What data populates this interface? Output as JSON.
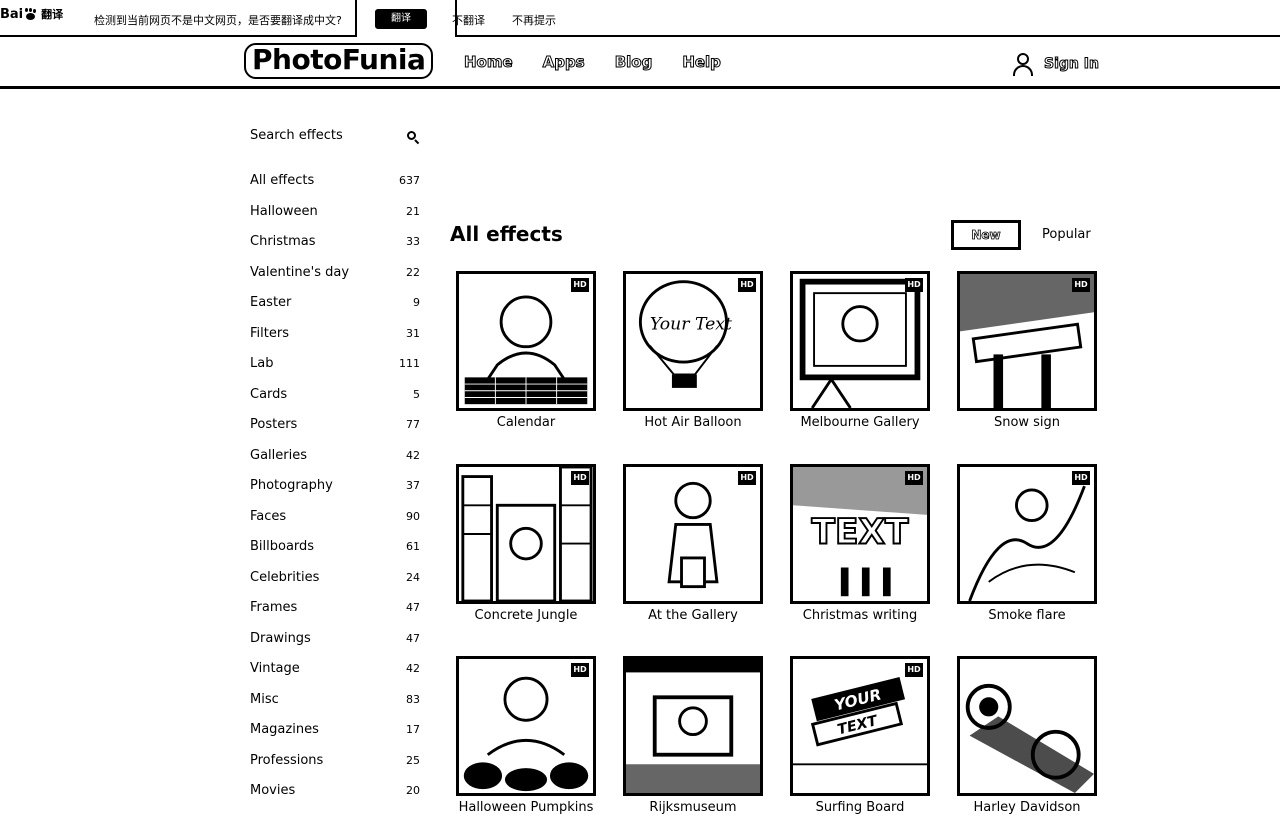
{
  "baidu_bar": {
    "logo_text": "Bai",
    "logo_sub": "翻译",
    "message": "检测到当前网页不是中文网页，是否要翻译成中文?",
    "translate_label": "翻译",
    "no_translate_label": "不翻译",
    "never_label": "不再提示"
  },
  "header": {
    "logo": "PhotoFunia",
    "nav": [
      "Home",
      "Apps",
      "Blog",
      "Help"
    ],
    "signin_label": "Sign In"
  },
  "sidebar": {
    "search_placeholder": "Search effects",
    "categories": [
      {
        "label": "All effects",
        "count": "637"
      },
      {
        "label": "Halloween",
        "count": "21"
      },
      {
        "label": "Christmas",
        "count": "33"
      },
      {
        "label": "Valentine's day",
        "count": "22"
      },
      {
        "label": "Easter",
        "count": "9"
      },
      {
        "label": "Filters",
        "count": "31"
      },
      {
        "label": "Lab",
        "count": "111"
      },
      {
        "label": "Cards",
        "count": "5"
      },
      {
        "label": "Posters",
        "count": "77"
      },
      {
        "label": "Galleries",
        "count": "42"
      },
      {
        "label": "Photography",
        "count": "37"
      },
      {
        "label": "Faces",
        "count": "90"
      },
      {
        "label": "Billboards",
        "count": "61"
      },
      {
        "label": "Celebrities",
        "count": "24"
      },
      {
        "label": "Frames",
        "count": "47"
      },
      {
        "label": "Drawings",
        "count": "47"
      },
      {
        "label": "Vintage",
        "count": "42"
      },
      {
        "label": "Misc",
        "count": "83"
      },
      {
        "label": "Magazines",
        "count": "17"
      },
      {
        "label": "Professions",
        "count": "25"
      },
      {
        "label": "Movies",
        "count": "20"
      }
    ]
  },
  "main": {
    "title": "All effects",
    "sort_new": "New",
    "sort_popular": "Popular",
    "effects": [
      {
        "label": "Calendar",
        "hd": true
      },
      {
        "label": "Hot Air Balloon",
        "hd": true
      },
      {
        "label": "Melbourne Gallery",
        "hd": true
      },
      {
        "label": "Snow sign",
        "hd": true
      },
      {
        "label": "Concrete Jungle",
        "hd": true
      },
      {
        "label": "At the Gallery",
        "hd": true
      },
      {
        "label": "Christmas writing",
        "hd": true
      },
      {
        "label": "Smoke flare",
        "hd": true
      },
      {
        "label": "Halloween Pumpkins",
        "hd": true
      },
      {
        "label": "Rijksmuseum",
        "hd": false
      },
      {
        "label": "Surfing Board",
        "hd": true
      },
      {
        "label": "Harley Davidson",
        "hd": false
      }
    ],
    "thumb_texts": {
      "balloon": "Your Text",
      "christmas": "TEXT",
      "surf_line1": "YOUR",
      "surf_line2": "TEXT"
    },
    "hd_label": "HD"
  }
}
